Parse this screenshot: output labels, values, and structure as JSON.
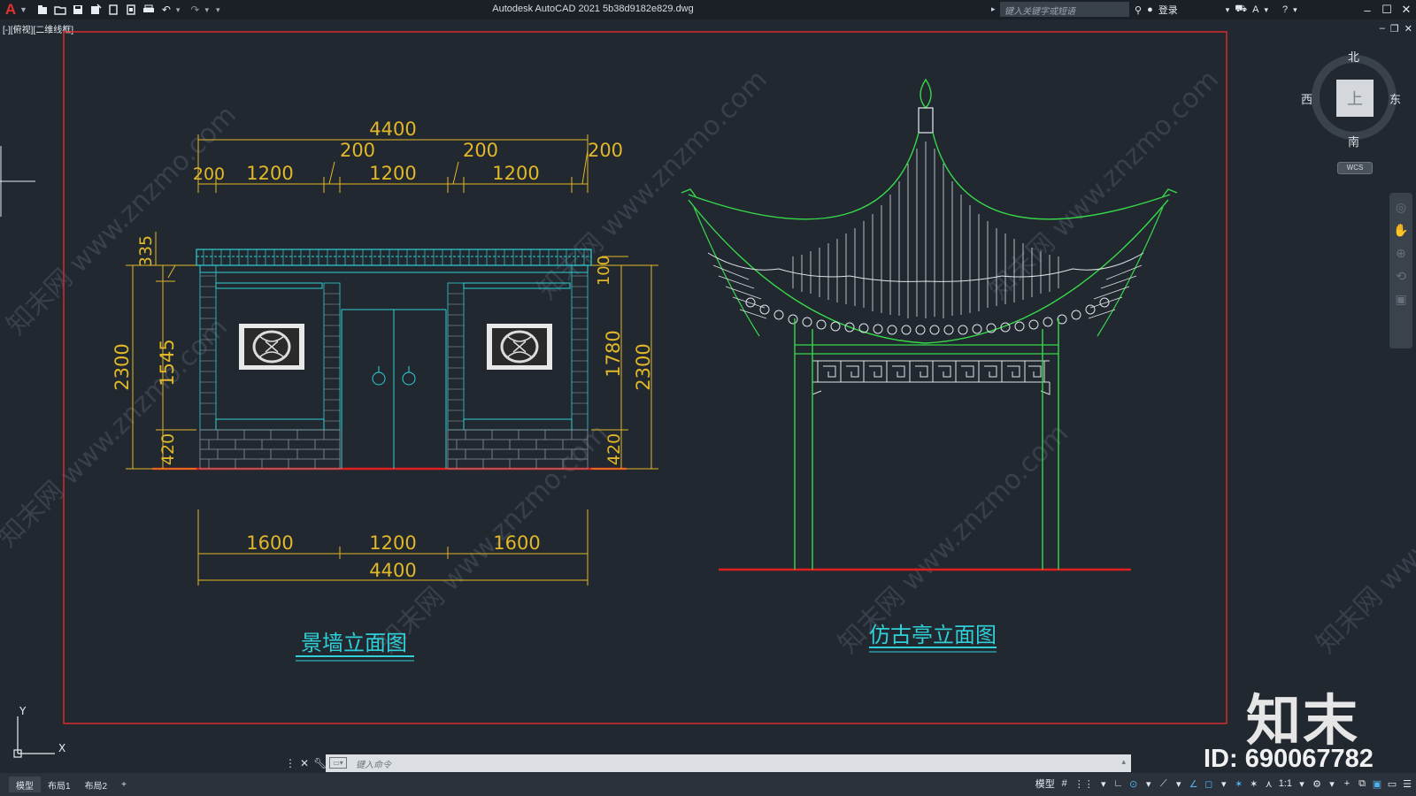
{
  "app": {
    "logo": "A",
    "title": "Autodesk AutoCAD 2021    5b38d9182e829.dwg",
    "search_placeholder": "键入关键字或短语",
    "login": "登录",
    "viewport_label": "[-][俯视][二维线框]"
  },
  "viewcube": {
    "north": "北",
    "south": "南",
    "east": "东",
    "west": "西",
    "face": "上",
    "wcs": "WCS"
  },
  "drawing": {
    "wall": {
      "title": "景墙立面图",
      "top_dims": {
        "total": "4400",
        "gaps": [
          "200",
          "200",
          "200"
        ],
        "first_gap": "200",
        "panels": [
          "1200",
          "1200",
          "1200"
        ]
      },
      "left_dims": [
        "335",
        "1545",
        "420",
        "2300"
      ],
      "right_dims": [
        "100",
        "1780",
        "420",
        "2300"
      ],
      "bottom_dims": {
        "segments": [
          "1600",
          "1200",
          "1600"
        ],
        "total": "4400"
      }
    },
    "pavilion": {
      "title": "仿古亭立面图"
    },
    "watermark": "知末网 www.znzmo.com"
  },
  "brand": {
    "name": "知末",
    "id": "ID: 690067782"
  },
  "cmdline": {
    "placeholder": "键入命令"
  },
  "status": {
    "tabs": [
      "模型",
      "布局1",
      "布局2"
    ],
    "add_tab": "+",
    "model": "模型",
    "scale": "1:1"
  },
  "colors": {
    "bg": "#212830",
    "dim": "#e2b728",
    "cyan": "#2fd0d8",
    "green": "#38d84a",
    "red": "#e01e1e",
    "frame": "#d42a2a"
  }
}
